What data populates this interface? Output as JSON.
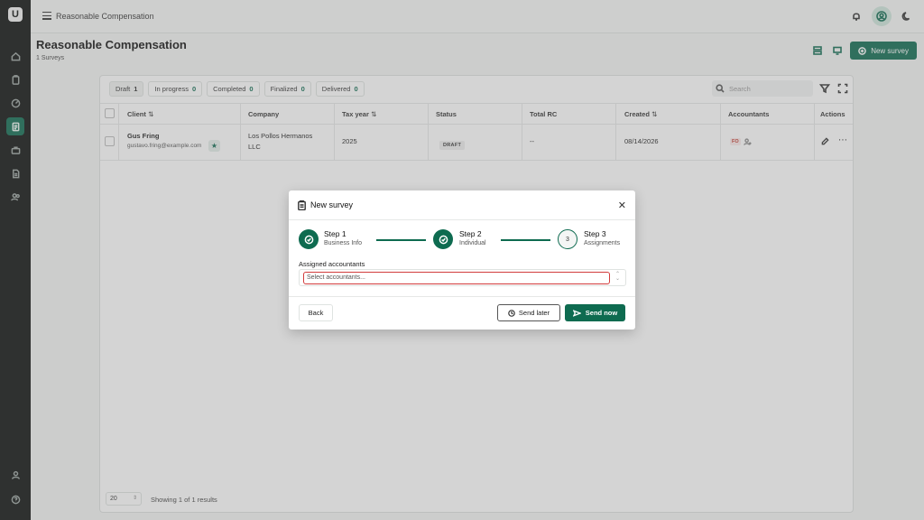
{
  "app": {
    "logo_text": "U"
  },
  "topbar": {
    "breadcrumb": "Reasonable Compensation"
  },
  "page": {
    "title": "Reasonable Compensation",
    "subtitle": "1 Surveys",
    "new_survey_label": "New survey"
  },
  "tabs": [
    {
      "label": "Draft",
      "count": "1"
    },
    {
      "label": "In progress",
      "count": "0"
    },
    {
      "label": "Completed",
      "count": "0"
    },
    {
      "label": "Finalized",
      "count": "0"
    },
    {
      "label": "Delivered",
      "count": "0"
    }
  ],
  "search": {
    "placeholder": "Search"
  },
  "table": {
    "headers": {
      "client": "Client",
      "company": "Company",
      "tax_year": "Tax year",
      "status": "Status",
      "total_rc": "Total RC",
      "created": "Created",
      "accountants": "Accountants",
      "actions": "Actions"
    },
    "sort_glyph": "⇅",
    "rows": [
      {
        "client_name": "Gus Fring",
        "client_email": "gustavo.fring@example.com",
        "company_line1": "Los Pollos Hermanos",
        "company_line2": "LLC",
        "tax_year": "2025",
        "status": "DRAFT",
        "total_rc": "--",
        "created": "08/14/2026",
        "accountant_initials": "FO"
      }
    ]
  },
  "pagination": {
    "page_size": "20",
    "summary": "Showing 1 of 1 results"
  },
  "modal": {
    "title": "New survey",
    "steps": [
      {
        "title": "Step 1",
        "subtitle": "Business Info",
        "state": "done"
      },
      {
        "title": "Step 2",
        "subtitle": "Individual",
        "state": "done"
      },
      {
        "title": "Step 3",
        "subtitle": "Assignments",
        "state": "current",
        "number": "3"
      }
    ],
    "field_label": "Assigned accountants",
    "field_placeholder": "Select accountants...",
    "back_label": "Back",
    "send_later_label": "Send later",
    "send_now_label": "Send now"
  },
  "colors": {
    "brand": "#0e6b50",
    "sidebar": "#0c0f0e",
    "error": "#d23c3c"
  }
}
